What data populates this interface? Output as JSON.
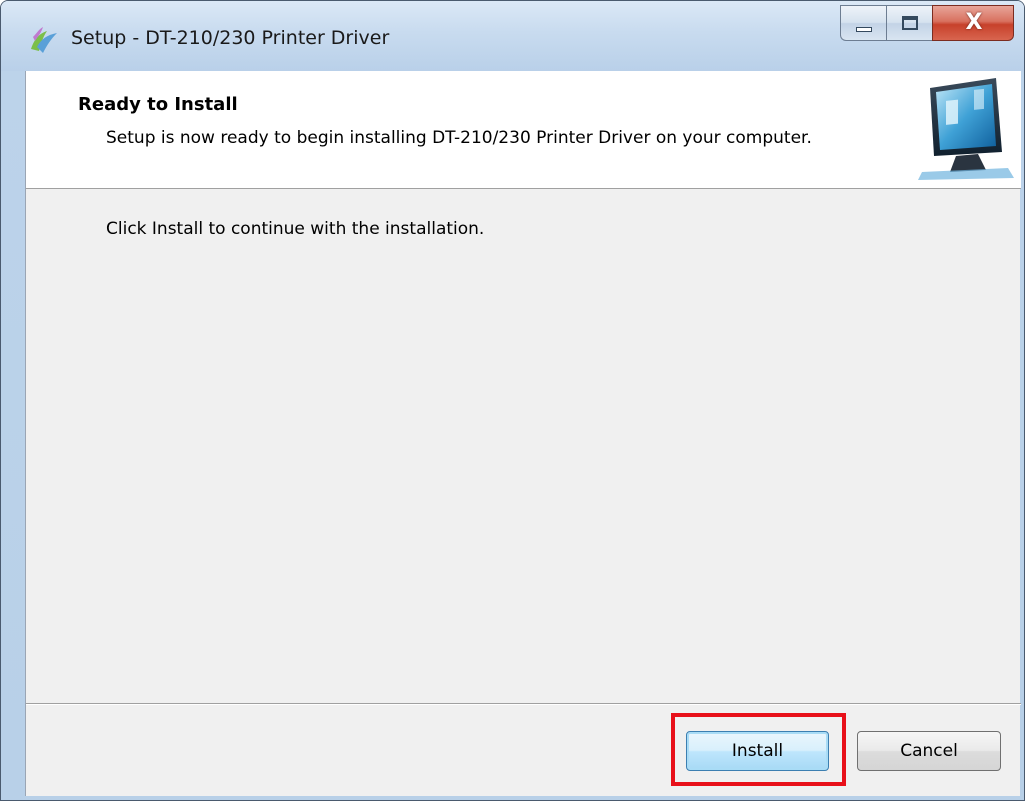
{
  "window": {
    "title": "Setup - DT-210/230 Printer Driver",
    "app_icon": "installer-icon",
    "caption": {
      "minimize_icon": "minimize-icon",
      "maximize_icon": "maximize-icon",
      "close_glyph": "X"
    }
  },
  "header": {
    "title": "Ready to Install",
    "description": "Setup is now ready to begin installing DT-210/230 Printer Driver on your computer.",
    "graphic_icon": "computer-monitor-icon"
  },
  "body": {
    "instruction": "Click Install to continue with the installation."
  },
  "buttons": {
    "install_label": "Install",
    "cancel_label": "Cancel"
  },
  "colors": {
    "highlight": "#e8101a",
    "install_border": "#3c7fb1"
  }
}
